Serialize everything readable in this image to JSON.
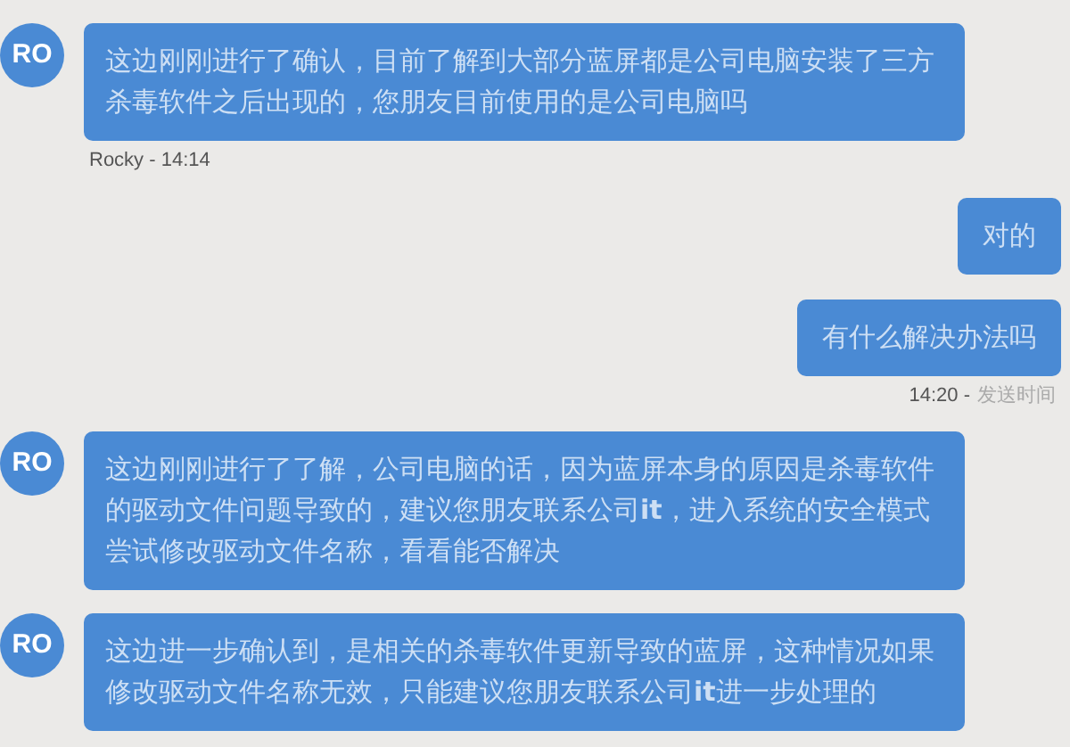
{
  "messages": [
    {
      "kind": "agent",
      "avatar": "RO",
      "text": "这边刚刚进行了确认，目前了解到大部分蓝屏都是公司电脑安装了三方杀毒软件之后出现的，您朋友目前使用的是公司电脑吗"
    },
    {
      "kind": "agent_meta",
      "time": "Rocky - 14:14"
    },
    {
      "kind": "user",
      "text": "对的"
    },
    {
      "kind": "user",
      "text": "有什么解决办法吗"
    },
    {
      "kind": "user_meta",
      "time": "14:20 -",
      "label": "发送时间"
    },
    {
      "kind": "agent",
      "avatar": "RO",
      "text": "这边刚刚进行了了解，公司电脑的话，因为蓝屏本身的原因是杀毒软件的驱动文件问题导致的，建议您朋友联系公司**it**，进入系统的安全模式尝试修改驱动文件名称，看看能否解决"
    },
    {
      "kind": "agent",
      "avatar": "RO",
      "text": "这边进一步确认到，是相关的杀毒软件更新导致的蓝屏，这种情况如果修改驱动文件名称无效，只能建议您朋友联系公司**it**进一步处理的"
    }
  ]
}
